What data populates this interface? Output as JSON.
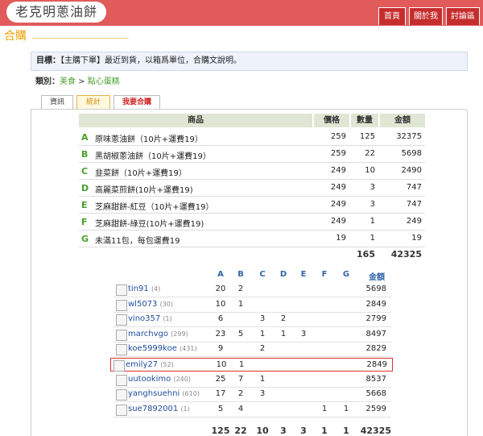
{
  "header": {
    "site_title": "老克明蔥油餅",
    "nav": [
      "首頁",
      "關於我",
      "討論區"
    ]
  },
  "section_title": "合購",
  "goal": {
    "label": "目標：",
    "text": "【主購下單】最近到貨，以箱爲單位，合購文說明。"
  },
  "category": {
    "label": "類別：",
    "path1": "美食",
    "sep": " > ",
    "path2": "點心蛋糕"
  },
  "tabs": [
    "資訊",
    "統計",
    "我要合購"
  ],
  "products": {
    "headers": {
      "name": "商品",
      "price": "價格",
      "qty": "數量",
      "amount": "金額"
    },
    "rows": [
      {
        "letter": "A",
        "name": "原味蔥油餅（10片+運費19）",
        "price": "259",
        "qty": "125",
        "amount": "32375"
      },
      {
        "letter": "B",
        "name": "黑胡椒蔥油餅（10片+運費19）",
        "price": "259",
        "qty": "22",
        "amount": "5698"
      },
      {
        "letter": "C",
        "name": "韭菜餅（10片+運費19）",
        "price": "249",
        "qty": "10",
        "amount": "2490"
      },
      {
        "letter": "D",
        "name": "高麗菜煎餅(10片+運費19)",
        "price": "249",
        "qty": "3",
        "amount": "747"
      },
      {
        "letter": "E",
        "name": "芝麻甜餅-紅豆（10片+運費19）",
        "price": "249",
        "qty": "3",
        "amount": "747"
      },
      {
        "letter": "F",
        "name": "芝麻甜餅-綠豆(10片+運費19)",
        "price": "249",
        "qty": "1",
        "amount": "249"
      },
      {
        "letter": "G",
        "name": "未滿11包，每包運費19",
        "price": "19",
        "qty": "1",
        "amount": "19"
      }
    ],
    "total_qty": "165",
    "total_amount": "42325"
  },
  "orders": {
    "letters": [
      "A",
      "B",
      "C",
      "D",
      "E",
      "F",
      "G"
    ],
    "amount_header": "金額",
    "rows": [
      {
        "user": "tin91",
        "count": "(4)",
        "q": [
          "20",
          "2",
          "",
          "",
          "",
          "",
          ""
        ],
        "amount": "5698",
        "highlight": false
      },
      {
        "user": "wl5073",
        "count": "(30)",
        "q": [
          "10",
          "1",
          "",
          "",
          "",
          "",
          ""
        ],
        "amount": "2849",
        "highlight": false
      },
      {
        "user": "vino357",
        "count": "(1)",
        "q": [
          "6",
          "",
          "3",
          "2",
          "",
          "",
          ""
        ],
        "amount": "2799",
        "highlight": false
      },
      {
        "user": "marchvgo",
        "count": "(299)",
        "q": [
          "23",
          "5",
          "1",
          "1",
          "3",
          "",
          ""
        ],
        "amount": "8497",
        "highlight": false
      },
      {
        "user": "koe5999koe",
        "count": "(431)",
        "q": [
          "9",
          "",
          "2",
          "",
          "",
          "",
          ""
        ],
        "amount": "2829",
        "highlight": false
      },
      {
        "user": "emily27",
        "count": "(52)",
        "q": [
          "10",
          "1",
          "",
          "",
          "",
          "",
          ""
        ],
        "amount": "2849",
        "highlight": true
      },
      {
        "user": "uutookimo",
        "count": "(240)",
        "q": [
          "25",
          "7",
          "1",
          "",
          "",
          "",
          ""
        ],
        "amount": "8537",
        "highlight": false
      },
      {
        "user": "yanghsuehni",
        "count": "(610)",
        "q": [
          "17",
          "2",
          "3",
          "",
          "",
          "",
          ""
        ],
        "amount": "5668",
        "highlight": false
      },
      {
        "user": "sue7892001",
        "count": "(1)",
        "q": [
          "5",
          "4",
          "",
          "",
          "",
          "1",
          "1"
        ],
        "amount": "2599",
        "highlight": false
      }
    ],
    "totals": [
      "125",
      "22",
      "10",
      "3",
      "3",
      "1",
      "1"
    ],
    "total_amount": "42325"
  },
  "colors": {
    "header": "#e15b5b",
    "nav_button": "#c62d2d",
    "accent_orange": "#f0a000",
    "letter_green": "#47a02c",
    "highlight_border": "#dd3333"
  }
}
